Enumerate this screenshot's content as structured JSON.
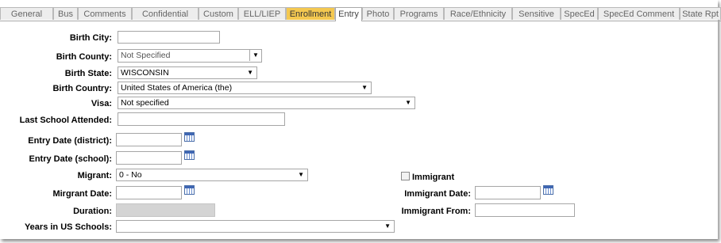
{
  "tabs": [
    {
      "label": "General",
      "state": "normal"
    },
    {
      "label": "Bus",
      "state": "normal"
    },
    {
      "label": "Comments",
      "state": "normal"
    },
    {
      "label": "Confidential",
      "state": "normal"
    },
    {
      "label": "Custom",
      "state": "normal"
    },
    {
      "label": "ELL/LIEP",
      "state": "normal"
    },
    {
      "label": "Enrollment",
      "state": "highlight"
    },
    {
      "label": "Entry",
      "state": "active"
    },
    {
      "label": "Photo",
      "state": "normal"
    },
    {
      "label": "Programs",
      "state": "normal"
    },
    {
      "label": "Race/Ethnicity",
      "state": "normal"
    },
    {
      "label": "Sensitive",
      "state": "normal"
    },
    {
      "label": "SpecEd",
      "state": "normal"
    },
    {
      "label": "SpecEd Comment",
      "state": "normal"
    },
    {
      "label": "State Rpt",
      "state": "normal"
    }
  ],
  "colors": {
    "highlight_tab": "#f4c850",
    "disabled_field": "#d4d4d4",
    "calendar_icon": "#3f66b3"
  },
  "form": {
    "birth_city": {
      "label": "Birth City:",
      "value": ""
    },
    "birth_county": {
      "label": "Birth County:",
      "value": "Not Specified"
    },
    "birth_state": {
      "label": "Birth State:",
      "value": "WISCONSIN"
    },
    "birth_country": {
      "label": "Birth Country:",
      "value": "United States of America (the)"
    },
    "visa": {
      "label": "Visa:",
      "value": "Not specified"
    },
    "last_school": {
      "label": "Last School Attended:",
      "value": ""
    },
    "entry_date_district": {
      "label": "Entry Date (district):",
      "value": ""
    },
    "entry_date_school": {
      "label": "Entry Date (school):",
      "value": ""
    },
    "migrant": {
      "label": "Migrant:",
      "value": "0 - No"
    },
    "migrant_date": {
      "label": "Mirgrant Date:",
      "value": ""
    },
    "duration": {
      "label": "Duration:",
      "value": ""
    },
    "years_us_schools": {
      "label": "Years in US Schools:",
      "value": ""
    },
    "immigrant": {
      "label": "Immigrant",
      "checked": false
    },
    "immigrant_date": {
      "label": "Immigrant Date:",
      "value": ""
    },
    "immigrant_from": {
      "label": "Immigrant From:",
      "value": ""
    }
  },
  "icons": {
    "dropdown": "▼",
    "calendar": "calendar-icon"
  }
}
